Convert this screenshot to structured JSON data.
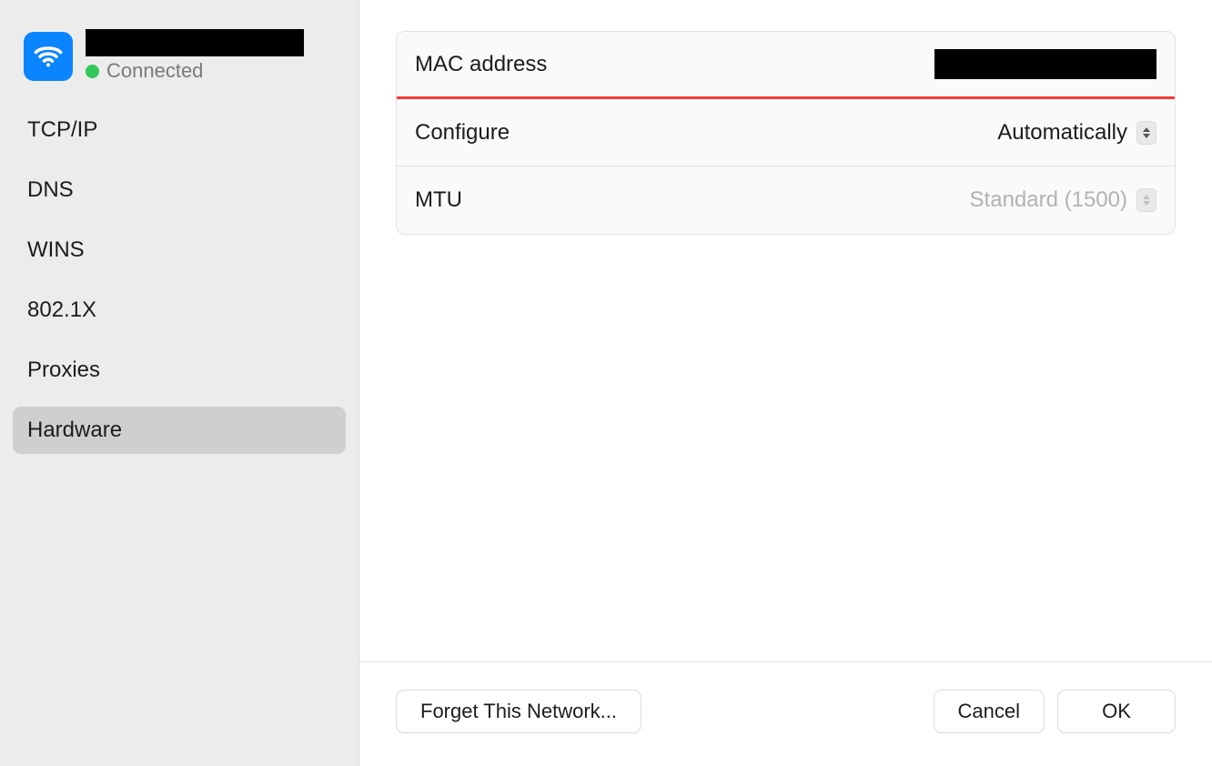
{
  "sidebar": {
    "status_label": "Connected",
    "items": [
      {
        "label": "TCP/IP"
      },
      {
        "label": "DNS"
      },
      {
        "label": "WINS"
      },
      {
        "label": "802.1X"
      },
      {
        "label": "Proxies"
      },
      {
        "label": "Hardware"
      }
    ]
  },
  "main": {
    "rows": {
      "mac_address": {
        "label": "MAC address"
      },
      "configure": {
        "label": "Configure",
        "value": "Automatically"
      },
      "mtu": {
        "label": "MTU",
        "value": "Standard (1500)"
      }
    }
  },
  "footer": {
    "forget_label": "Forget This Network...",
    "cancel_label": "Cancel",
    "ok_label": "OK"
  }
}
